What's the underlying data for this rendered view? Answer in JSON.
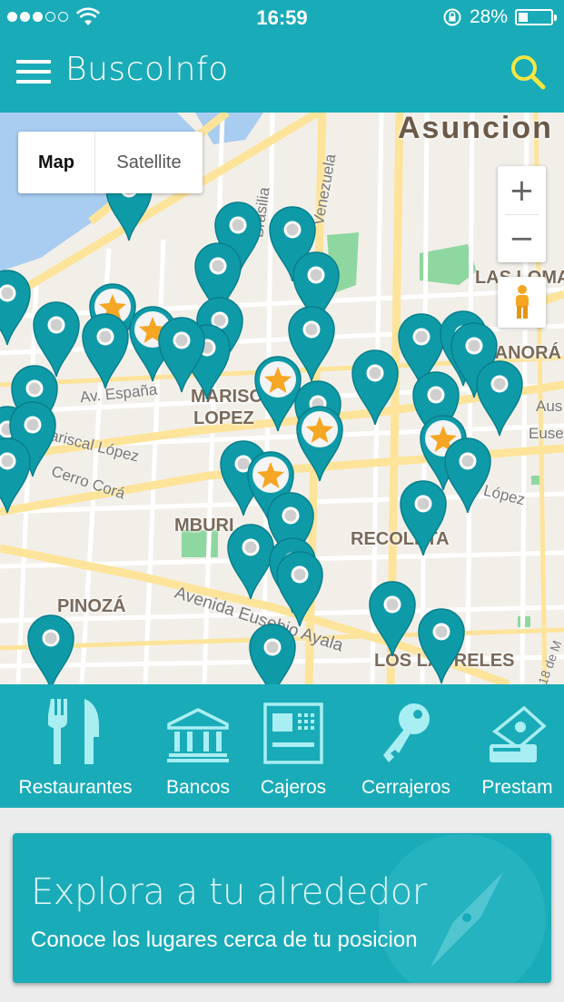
{
  "status": {
    "time": "16:59",
    "battery": "28%"
  },
  "app": {
    "title": "BuscoInfo"
  },
  "map": {
    "type_options": [
      "Map",
      "Satellite"
    ],
    "selected_type": "Map",
    "zoom_in": "+",
    "zoom_out": "−",
    "labels": {
      "city": "Asuncion",
      "las_lomas": "LAS LOMA",
      "manora": "MANORÁ",
      "mariscal_a": "MARISC",
      "mariscal_b": "LOPEZ",
      "mburicao": "MBURI",
      "recoleta": "RECOLETA",
      "pinoza": "PINOZÁ",
      "los_laureles": "LOS LAURELES",
      "av_espana": "Av. España",
      "mariscal_lopez": "Mariscal López",
      "cerro_cora": "Cerro Corá",
      "lopez_right": "López",
      "eusebio_ayala": "Avenida Eusebio Ayala",
      "venezuela": "Venezuela",
      "brasilia": "Brasilia",
      "ause": "Aus",
      "euse": "Euse",
      "de_mayo": "18 de M"
    },
    "marker_icon": "map-pin-icon",
    "featured_icon": "star-icon"
  },
  "categories": [
    {
      "label": "Restaurantes",
      "icon": "fork-knife-icon"
    },
    {
      "label": "Bancos",
      "icon": "bank-icon"
    },
    {
      "label": "Cajeros",
      "icon": "atm-icon"
    },
    {
      "label": "Cerrajeros",
      "icon": "key-icon"
    },
    {
      "label": "Prestam",
      "icon": "loan-icon"
    }
  ],
  "explore": {
    "title": "Explora a tu alrededor",
    "subtitle": "Conoce los lugares cerca de tu posicion"
  },
  "colors": {
    "primary": "#1aabb8",
    "marker": "#0f9aa8",
    "star": "#f5a623"
  }
}
